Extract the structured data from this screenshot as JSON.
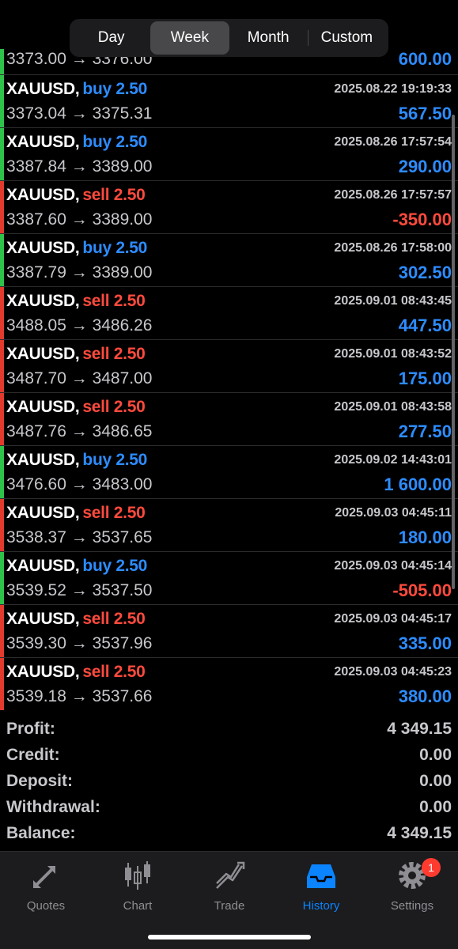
{
  "period_tabs": [
    "Day",
    "Week",
    "Month",
    "Custom"
  ],
  "active_period": "Week",
  "partial_top_deal": {
    "prices": "3373.00 → 3376.00",
    "profit": "600.00"
  },
  "deals": [
    {
      "symbol": "XAUUSD,",
      "side": "buy",
      "volume": "buy 2.50",
      "time": "2025.08.22 19:19:33",
      "prices": "3373.04 → 3375.31",
      "profit": "567.50",
      "sign": "pos"
    },
    {
      "symbol": "XAUUSD,",
      "side": "buy",
      "volume": "buy 2.50",
      "time": "2025.08.26 17:57:54",
      "prices": "3387.84 → 3389.00",
      "profit": "290.00",
      "sign": "pos"
    },
    {
      "symbol": "XAUUSD,",
      "side": "sell",
      "volume": "sell 2.50",
      "time": "2025.08.26 17:57:57",
      "prices": "3387.60 → 3389.00",
      "profit": "-350.00",
      "sign": "neg"
    },
    {
      "symbol": "XAUUSD,",
      "side": "buy",
      "volume": "buy 2.50",
      "time": "2025.08.26 17:58:00",
      "prices": "3387.79 → 3389.00",
      "profit": "302.50",
      "sign": "pos"
    },
    {
      "symbol": "XAUUSD,",
      "side": "sell",
      "volume": "sell 2.50",
      "time": "2025.09.01 08:43:45",
      "prices": "3488.05 → 3486.26",
      "profit": "447.50",
      "sign": "pos"
    },
    {
      "symbol": "XAUUSD,",
      "side": "sell",
      "volume": "sell 2.50",
      "time": "2025.09.01 08:43:52",
      "prices": "3487.70 → 3487.00",
      "profit": "175.00",
      "sign": "pos"
    },
    {
      "symbol": "XAUUSD,",
      "side": "sell",
      "volume": "sell 2.50",
      "time": "2025.09.01 08:43:58",
      "prices": "3487.76 → 3486.65",
      "profit": "277.50",
      "sign": "pos"
    },
    {
      "symbol": "XAUUSD,",
      "side": "buy",
      "volume": "buy 2.50",
      "time": "2025.09.02 14:43:01",
      "prices": "3476.60 → 3483.00",
      "profit": "1 600.00",
      "sign": "pos"
    },
    {
      "symbol": "XAUUSD,",
      "side": "sell",
      "volume": "sell 2.50",
      "time": "2025.09.03 04:45:11",
      "prices": "3538.37 → 3537.65",
      "profit": "180.00",
      "sign": "pos"
    },
    {
      "symbol": "XAUUSD,",
      "side": "buy",
      "volume": "buy 2.50",
      "time": "2025.09.03 04:45:14",
      "prices": "3539.52 → 3537.50",
      "profit": "-505.00",
      "sign": "neg"
    },
    {
      "symbol": "XAUUSD,",
      "side": "sell",
      "volume": "sell 2.50",
      "time": "2025.09.03 04:45:17",
      "prices": "3539.30 → 3537.96",
      "profit": "335.00",
      "sign": "pos"
    },
    {
      "symbol": "XAUUSD,",
      "side": "sell",
      "volume": "sell 2.50",
      "time": "2025.09.03 04:45:23",
      "prices": "3539.18 → 3537.66",
      "profit": "380.00",
      "sign": "pos"
    }
  ],
  "summary": [
    {
      "label": "Profit:",
      "value": "4 349.15"
    },
    {
      "label": "Credit:",
      "value": "0.00"
    },
    {
      "label": "Deposit:",
      "value": "0.00"
    },
    {
      "label": "Withdrawal:",
      "value": "0.00"
    },
    {
      "label": "Balance:",
      "value": "4 349.15"
    }
  ],
  "tabbar": {
    "quotes": "Quotes",
    "chart": "Chart",
    "trade": "Trade",
    "history": "History",
    "settings": "Settings",
    "settings_badge": "1"
  },
  "colors": {
    "buy": "#2d8cff",
    "sell": "#ff4a3d",
    "buy_bar": "#2fc24a",
    "sell_bar": "#e23b2e",
    "active_tab": "#0a84ff"
  }
}
